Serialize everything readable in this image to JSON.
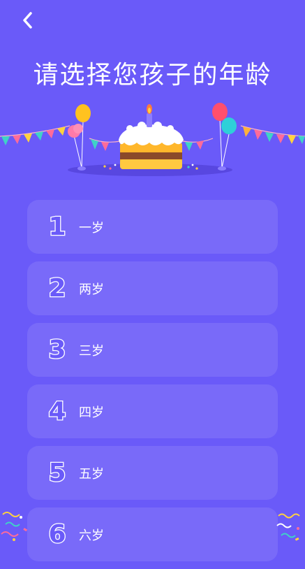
{
  "header": {
    "back_icon": "chevron-left-icon",
    "title": "请选择您孩子的年龄"
  },
  "ages": [
    {
      "number": "1",
      "label": "一岁"
    },
    {
      "number": "2",
      "label": "两岁"
    },
    {
      "number": "3",
      "label": "三岁"
    },
    {
      "number": "4",
      "label": "四岁"
    },
    {
      "number": "5",
      "label": "五岁"
    },
    {
      "number": "6",
      "label": "六岁"
    }
  ],
  "colors": {
    "background": "#6a5af9",
    "card": "#7d6ffa",
    "text": "#ffffff"
  }
}
